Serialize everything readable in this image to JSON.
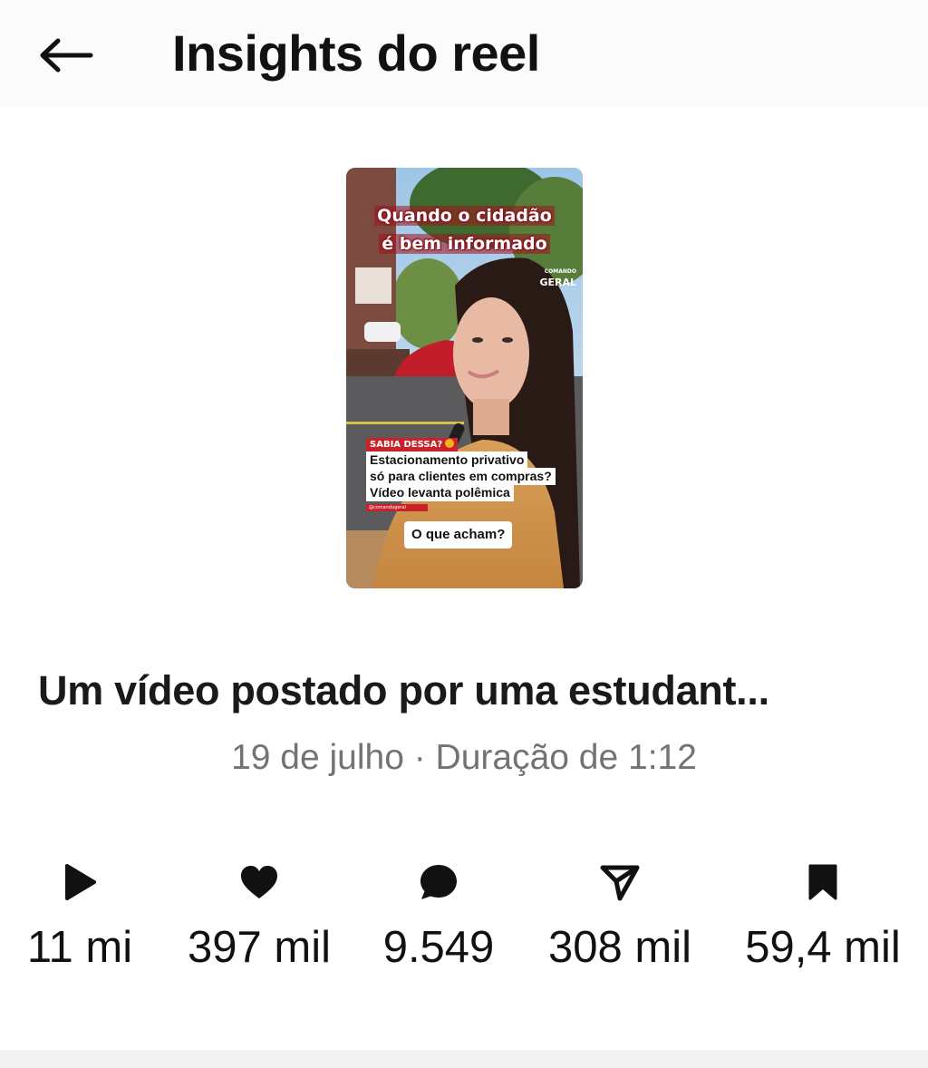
{
  "header": {
    "title": "Insights do reel",
    "back_icon": "arrow-left-icon"
  },
  "thumbnail": {
    "caption_line1": "Quando o cidadão",
    "caption_line2": "é bem informado",
    "brand_small": "COMANDO",
    "brand_large": "GERAL",
    "tag": "SABIA DESSA?",
    "text_line1": "Estacionamento privativo",
    "text_line2": "só para clientes em compras?",
    "text_line3": "Vídeo levanta polêmica",
    "handle": "@comandogeral",
    "question": "O que acham?"
  },
  "reel": {
    "caption": "Um vídeo postado por uma estudant...",
    "meta": "19 de julho · Duração de 1:12"
  },
  "stats": [
    {
      "icon": "play-icon",
      "value": "11 mi"
    },
    {
      "icon": "heart-icon",
      "value": "397 mil"
    },
    {
      "icon": "comment-icon",
      "value": "9.549"
    },
    {
      "icon": "share-icon",
      "value": "308 mil"
    },
    {
      "icon": "bookmark-icon",
      "value": "59,4 mil"
    }
  ],
  "colors": {
    "text": "#111111",
    "meta": "#737373",
    "caption_accent": "#c8222b"
  }
}
